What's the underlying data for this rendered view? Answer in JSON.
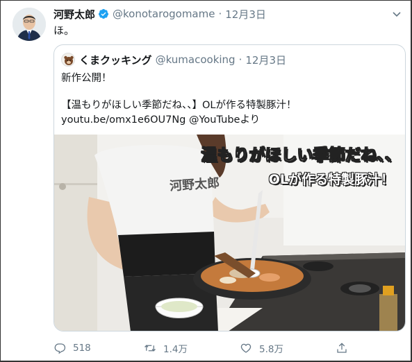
{
  "tweet": {
    "author_name": "河野太郎",
    "author_handle": "@konotarogomame",
    "separator": "·",
    "date": "12月3日",
    "text": "ほ。"
  },
  "quoted_tweet": {
    "author_name": "くまクッキング",
    "author_handle": "@kumacooking",
    "separator": "·",
    "date": "12月3日",
    "line1": "新作公開！",
    "line2": "【温もりがほしい季節だね、、】OLが作る特製豚汁！",
    "link": "youtu.be/omx1e6OU7Ng",
    "link_suffix": " @YouTubeより"
  },
  "media": {
    "caption_line1": "温もりがほしい季節だね、、",
    "caption_line2": "OLが作る特製豚汁！",
    "shirt_text": "河野太郎"
  },
  "actions": {
    "reply_count": "518",
    "retweet_count": "1.4万",
    "like_count": "5.8万"
  },
  "icons": {
    "verified": "verified-badge-icon",
    "more": "chevron-down-icon",
    "reply": "reply-icon",
    "retweet": "retweet-icon",
    "like": "heart-icon",
    "share": "share-icon"
  },
  "colors": {
    "verified_blue": "#1da1f2",
    "secondary_text": "#657786",
    "border": "#ccd6dd"
  }
}
